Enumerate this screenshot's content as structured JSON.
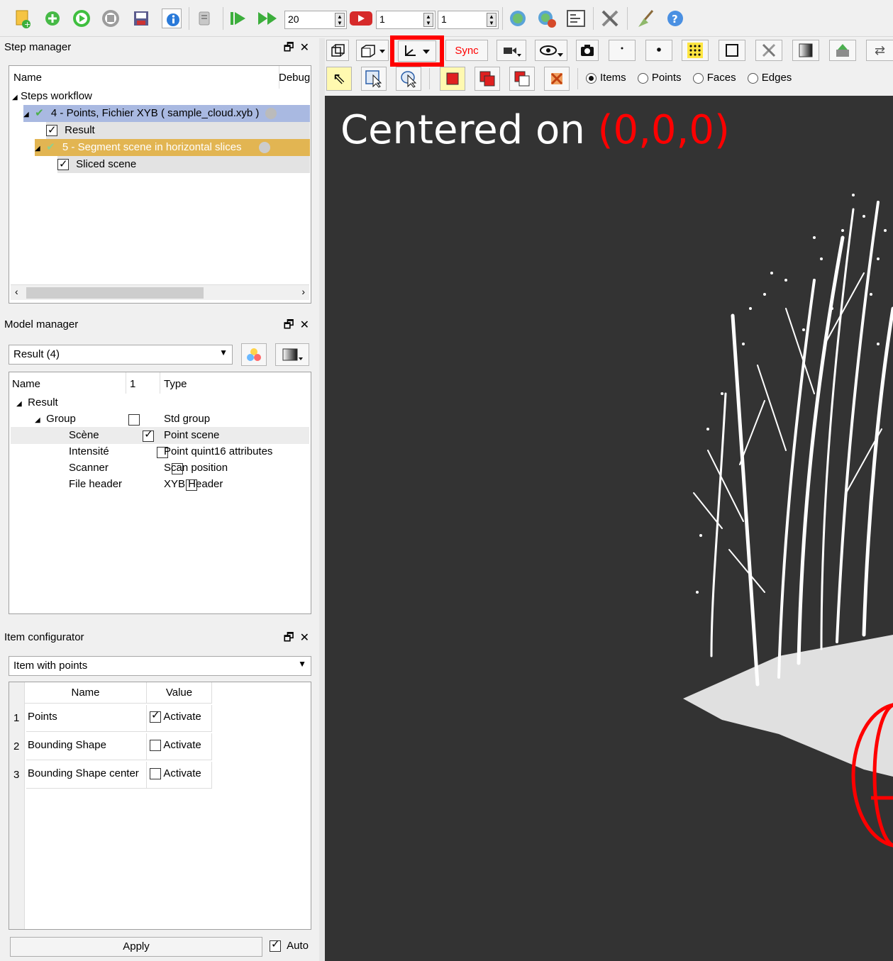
{
  "toolbar": {
    "spin1": "20",
    "spin2": "1",
    "spin3": "1",
    "icons": [
      "new-step-icon",
      "add-icon",
      "play-icon",
      "stop-icon",
      "save-icon",
      "info-icon",
      "plugin-icon",
      "step-forward-icon",
      "fast-forward-icon",
      "debug-record-icon",
      "cloud-add-icon",
      "cloud-export-icon",
      "doc-icon",
      "tools-icon",
      "broom-icon",
      "help-icon"
    ]
  },
  "step_manager": {
    "title": "Step manager",
    "col_name": "Name",
    "col_debug": "Debug",
    "root": "Steps workflow",
    "step4": "4 - Points, Fichier XYB ( sample_cloud.xyb )",
    "step4_result": "Result",
    "step5": "5 - Segment scene in horizontal slices",
    "step5_result": "Sliced scene"
  },
  "model_manager": {
    "title": "Model manager",
    "selector": "Result (4)",
    "col_name": "Name",
    "col_one": "1",
    "col_type": "Type",
    "rows": [
      {
        "name": "Result",
        "type": ""
      },
      {
        "name": "Group",
        "type": "Std group"
      },
      {
        "name": "Scène",
        "type": "Point scene"
      },
      {
        "name": "Intensité",
        "type": "Point quint16 attributes"
      },
      {
        "name": "Scanner",
        "type": "Scan position"
      },
      {
        "name": "File header",
        "type": "XYB Header"
      }
    ]
  },
  "item_configurator": {
    "title": "Item configurator",
    "selector": "Item with points",
    "col_name": "Name",
    "col_value": "Value",
    "rows": [
      {
        "idx": "1",
        "name": "Points",
        "value": "Activate",
        "checked": true
      },
      {
        "idx": "2",
        "name": "Bounding Shape",
        "value": "Activate",
        "checked": false
      },
      {
        "idx": "3",
        "name": "Bounding Shape center",
        "value": "Activate",
        "checked": false
      }
    ],
    "apply": "Apply",
    "auto": "Auto"
  },
  "viewer_toolbar": {
    "sync": "Sync",
    "items": "Items",
    "points": "Points",
    "faces": "Faces",
    "edges": "Edges",
    "highlight_color": "#ff0000"
  },
  "viewer": {
    "caption_prefix": "Centered on ",
    "caption_coords": "(0,0,0)",
    "background": "#333333",
    "accent": "#ff0000"
  }
}
